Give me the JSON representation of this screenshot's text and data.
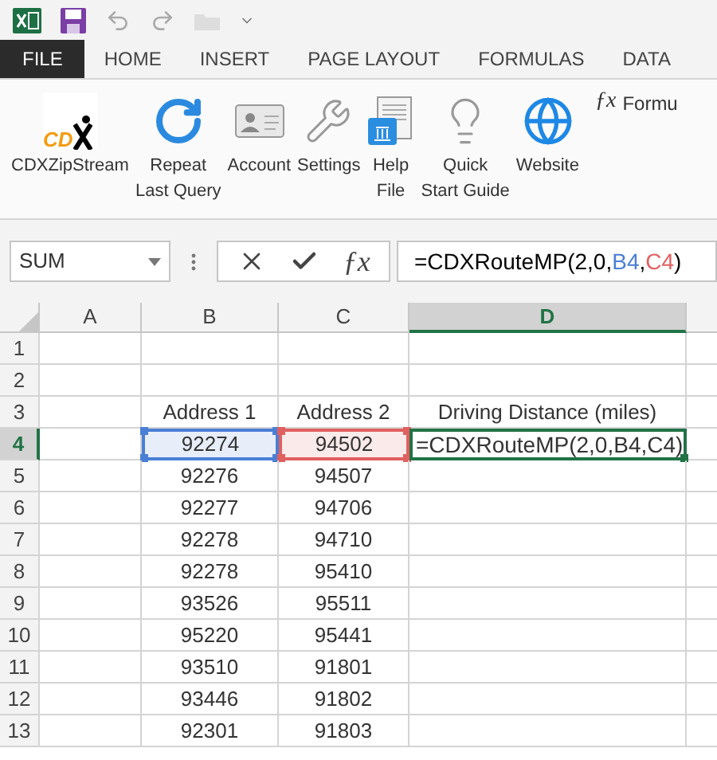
{
  "tabs": [
    {
      "label": "FILE",
      "kind": "file",
      "selected": false
    },
    {
      "label": "HOME",
      "kind": "tab",
      "selected": false
    },
    {
      "label": "INSERT",
      "kind": "tab",
      "selected": false
    },
    {
      "label": "PAGE LAYOUT",
      "kind": "tab",
      "selected": false
    },
    {
      "label": "FORMULAS",
      "kind": "tab",
      "selected": false
    },
    {
      "label": "DATA",
      "kind": "tab",
      "selected": false
    }
  ],
  "ribbon": {
    "buttons": [
      {
        "kind": "logo",
        "logo_text": "CD",
        "lines": [
          "CDXZipStream"
        ]
      },
      {
        "kind": "repeat",
        "lines": [
          "Repeat",
          "Last Query"
        ]
      },
      {
        "kind": "account",
        "lines": [
          "Account"
        ]
      },
      {
        "kind": "settings",
        "lines": [
          "Settings"
        ]
      },
      {
        "kind": "help",
        "lines": [
          "Help",
          "File"
        ]
      },
      {
        "kind": "bulb",
        "lines": [
          "Quick",
          "Start Guide"
        ]
      },
      {
        "kind": "globe",
        "lines": [
          "Website"
        ]
      }
    ],
    "fx_label": "ƒx",
    "formula_label": "Formu"
  },
  "formula_bar": {
    "name_box": "SUM",
    "fx_label": "ƒx",
    "formula": [
      {
        "text": "=CDXRouteMP(2,0,",
        "kind": "text"
      },
      {
        "text": "B4",
        "kind": "ref",
        "color": "#4a7fd6",
        "after": ","
      },
      {
        "text": "C4",
        "kind": "ref",
        "color": "#e06060",
        "after": ")"
      }
    ]
  },
  "sheet": {
    "columns": [
      {
        "label": "A",
        "selected": false
      },
      {
        "label": "B",
        "selected": false
      },
      {
        "label": "C",
        "selected": false
      },
      {
        "label": "D",
        "selected": true
      }
    ],
    "rows": [
      {
        "header": "1",
        "selected": false,
        "cells": [
          {
            "text": ""
          },
          {
            "text": ""
          },
          {
            "text": ""
          },
          {
            "text": ""
          }
        ]
      },
      {
        "header": "2",
        "selected": false,
        "cells": [
          {
            "text": ""
          },
          {
            "text": ""
          },
          {
            "text": ""
          },
          {
            "text": ""
          }
        ]
      },
      {
        "header": "3",
        "selected": false,
        "cells": [
          {
            "text": ""
          },
          {
            "text": "Address 1"
          },
          {
            "text": "Address 2"
          },
          {
            "text": "Driving Distance (miles)"
          }
        ]
      },
      {
        "header": "4",
        "selected": true,
        "cells": [
          {
            "text": ""
          },
          {
            "text": "92274",
            "kind": "ref",
            "color": "#4a7fd6"
          },
          {
            "text": "94502",
            "kind": "ref",
            "color": "#e06060"
          },
          {
            "text": "=CDXRouteMP(2,0,B4,C4)",
            "kind": "editing"
          }
        ]
      },
      {
        "header": "5",
        "selected": false,
        "cells": [
          {
            "text": ""
          },
          {
            "text": "92276"
          },
          {
            "text": "94507"
          },
          {
            "text": ""
          }
        ]
      },
      {
        "header": "6",
        "selected": false,
        "cells": [
          {
            "text": ""
          },
          {
            "text": "92277"
          },
          {
            "text": "94706"
          },
          {
            "text": ""
          }
        ]
      },
      {
        "header": "7",
        "selected": false,
        "cells": [
          {
            "text": ""
          },
          {
            "text": "92278"
          },
          {
            "text": "94710"
          },
          {
            "text": ""
          }
        ]
      },
      {
        "header": "8",
        "selected": false,
        "cells": [
          {
            "text": ""
          },
          {
            "text": "92278"
          },
          {
            "text": "95410"
          },
          {
            "text": ""
          }
        ]
      },
      {
        "header": "9",
        "selected": false,
        "cells": [
          {
            "text": ""
          },
          {
            "text": "93526"
          },
          {
            "text": "95511"
          },
          {
            "text": ""
          }
        ]
      },
      {
        "header": "10",
        "selected": false,
        "cells": [
          {
            "text": ""
          },
          {
            "text": "95220"
          },
          {
            "text": "95441"
          },
          {
            "text": ""
          }
        ]
      },
      {
        "header": "11",
        "selected": false,
        "cells": [
          {
            "text": ""
          },
          {
            "text": "93510"
          },
          {
            "text": "91801"
          },
          {
            "text": ""
          }
        ]
      },
      {
        "header": "12",
        "selected": false,
        "cells": [
          {
            "text": ""
          },
          {
            "text": "93446"
          },
          {
            "text": "91802"
          },
          {
            "text": ""
          }
        ]
      },
      {
        "header": "13",
        "selected": false,
        "cells": [
          {
            "text": ""
          },
          {
            "text": "92301"
          },
          {
            "text": "91803"
          },
          {
            "text": ""
          }
        ]
      }
    ]
  }
}
